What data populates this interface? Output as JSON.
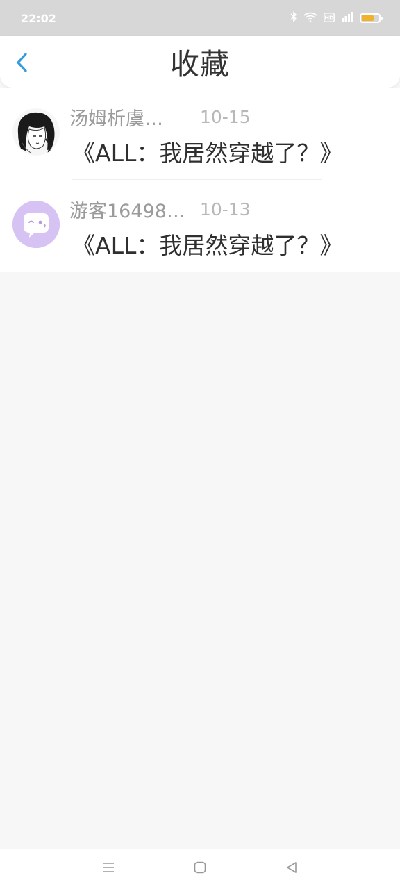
{
  "status_bar": {
    "time": "22:02",
    "icons": [
      "bluetooth-icon",
      "wifi-icon",
      "hd-icon",
      "signal-4g-icon",
      "battery-icon"
    ],
    "battery_level": 0.7,
    "battery_color": "#f0b12b"
  },
  "header": {
    "title": "收藏",
    "back_icon": "chevron-left-icon",
    "accent_color": "#2f9be0"
  },
  "favorites": [
    {
      "username": "汤姆析虞…",
      "date": "10-15",
      "title": "《ALL：我居然穿越了？》",
      "avatar": "manga-girl-avatar"
    },
    {
      "username": "游客16498…",
      "date": "10-13",
      "title": "《ALL：我居然穿越了？》",
      "avatar": "chat-bubble-avatar"
    }
  ],
  "nav_bar": {
    "items": [
      "menu-icon",
      "home-icon",
      "back-triangle-icon"
    ]
  }
}
